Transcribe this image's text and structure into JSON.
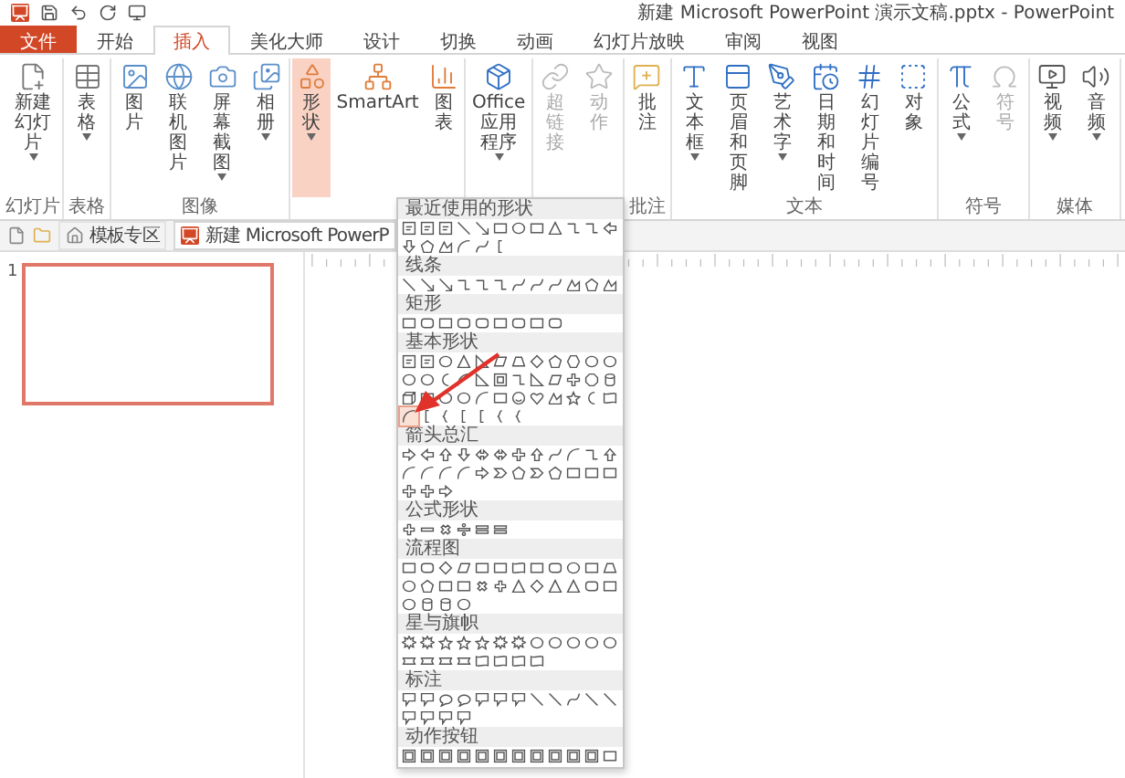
{
  "window": {
    "title": "新建 Microsoft PowerPoint 演示文稿.pptx - PowerPoint"
  },
  "tabs": [
    {
      "label": "文件",
      "kind": "file",
      "selected": false
    },
    {
      "label": "开始",
      "kind": "tab",
      "selected": false
    },
    {
      "label": "插入",
      "kind": "tab",
      "selected": true
    },
    {
      "label": "美化大师",
      "kind": "tab",
      "selected": false
    },
    {
      "label": "设计",
      "kind": "tab",
      "selected": false
    },
    {
      "label": "切换",
      "kind": "tab",
      "selected": false
    },
    {
      "label": "动画",
      "kind": "tab",
      "selected": false
    },
    {
      "label": "幻灯片放映",
      "kind": "tab",
      "selected": false
    },
    {
      "label": "审阅",
      "kind": "tab",
      "selected": false
    },
    {
      "label": "视图",
      "kind": "tab",
      "selected": false
    }
  ],
  "ribbon": [
    {
      "label": "幻灯片",
      "items": [
        {
          "label": "新建幻灯片",
          "menu": true,
          "disabled": false,
          "open": false
        }
      ]
    },
    {
      "label": "表格",
      "items": [
        {
          "label": "表格",
          "menu": true,
          "disabled": false,
          "open": false
        }
      ]
    },
    {
      "label": "图像",
      "items": [
        {
          "label": "图片",
          "menu": false,
          "disabled": false,
          "open": false
        },
        {
          "label": "联机图片",
          "menu": false,
          "disabled": false,
          "open": false
        },
        {
          "label": "屏幕截图",
          "menu": true,
          "disabled": false,
          "open": false
        },
        {
          "label": "相册",
          "menu": true,
          "disabled": false,
          "open": false
        }
      ]
    },
    {
      "items": [
        {
          "label": "形状",
          "menu": true,
          "disabled": false,
          "open": true
        },
        {
          "label": "SmartArt",
          "menu": false,
          "disabled": false,
          "open": false
        },
        {
          "label": "图表",
          "menu": false,
          "disabled": false,
          "open": false
        }
      ]
    },
    {
      "items": [
        {
          "label": "Office 应用程序",
          "menu": true,
          "disabled": false,
          "open": false
        }
      ]
    },
    {
      "items": [
        {
          "label": "超链接",
          "menu": false,
          "disabled": true,
          "open": false
        },
        {
          "label": "动作",
          "menu": false,
          "disabled": true,
          "open": false
        }
      ]
    },
    {
      "label": "批注",
      "items": [
        {
          "label": "批注",
          "menu": false,
          "disabled": false,
          "open": false
        }
      ]
    },
    {
      "label": "文本",
      "items": [
        {
          "label": "文本框",
          "menu": true,
          "disabled": false,
          "open": false
        },
        {
          "label": "页眉和页脚",
          "menu": false,
          "disabled": false,
          "open": false
        },
        {
          "label": "艺术字",
          "menu": true,
          "disabled": false,
          "open": false
        },
        {
          "label": "日期和时间",
          "menu": false,
          "disabled": false,
          "open": false
        },
        {
          "label": "幻灯片编号",
          "menu": false,
          "disabled": false,
          "open": false
        },
        {
          "label": "对象",
          "menu": false,
          "disabled": false,
          "open": false
        }
      ]
    },
    {
      "label": "符号",
      "items": [
        {
          "label": "公式",
          "menu": true,
          "disabled": false,
          "open": false
        },
        {
          "label": "符号",
          "menu": false,
          "disabled": true,
          "open": false
        }
      ]
    },
    {
      "label": "媒体",
      "items": [
        {
          "label": "视频",
          "menu": true,
          "disabled": false,
          "open": false
        },
        {
          "label": "音频",
          "menu": true,
          "disabled": false,
          "open": false
        }
      ]
    }
  ],
  "doc_tabs": [
    {
      "label": "模板专区",
      "kind": "home",
      "selected": false
    },
    {
      "label": "新建 Microsoft PowerP",
      "kind": "ppt",
      "selected": true
    }
  ],
  "slides": [
    {
      "number": "1",
      "selected": true
    }
  ],
  "annotation": {
    "kind": "arrow"
  },
  "shape_gallery": [
    {
      "title": "最近使用的形状",
      "shapes": [
        {
          "kind": "textbox",
          "selected": false
        },
        {
          "kind": "textbox",
          "selected": false
        },
        {
          "kind": "textbox",
          "selected": false
        },
        {
          "kind": "line",
          "selected": false
        },
        {
          "kind": "arrow-line",
          "selected": false
        },
        {
          "kind": "rect",
          "selected": false
        },
        {
          "kind": "oval",
          "selected": false
        },
        {
          "kind": "rect",
          "selected": false
        },
        {
          "kind": "triangle",
          "selected": false
        },
        {
          "kind": "elbow",
          "selected": false
        },
        {
          "kind": "elbow",
          "selected": false
        },
        {
          "kind": "arrow-left",
          "selected": false
        },
        {
          "kind": "arrow-down",
          "selected": false
        },
        {
          "kind": "pentagon",
          "selected": false
        },
        {
          "kind": "freeform",
          "selected": false
        },
        {
          "kind": "arc",
          "selected": false
        },
        {
          "kind": "curve",
          "selected": false
        },
        {
          "kind": "bracket",
          "selected": false
        }
      ]
    },
    {
      "title": "线条",
      "shapes": [
        {
          "kind": "line",
          "selected": false
        },
        {
          "kind": "arrow-line",
          "selected": false
        },
        {
          "kind": "arrow-line",
          "selected": false
        },
        {
          "kind": "elbow",
          "selected": false
        },
        {
          "kind": "elbow",
          "selected": false
        },
        {
          "kind": "elbow",
          "selected": false
        },
        {
          "kind": "curve",
          "selected": false
        },
        {
          "kind": "curve",
          "selected": false
        },
        {
          "kind": "curve",
          "selected": false
        },
        {
          "kind": "freeform",
          "selected": false
        },
        {
          "kind": "pentagon",
          "selected": false
        },
        {
          "kind": "freeform",
          "selected": false
        }
      ]
    },
    {
      "title": "矩形",
      "shapes": [
        {
          "kind": "rect",
          "selected": false
        },
        {
          "kind": "roundrect",
          "selected": false
        },
        {
          "kind": "rect",
          "selected": false
        },
        {
          "kind": "roundrect",
          "selected": false
        },
        {
          "kind": "roundrect",
          "selected": false
        },
        {
          "kind": "rect",
          "selected": false
        },
        {
          "kind": "roundrect",
          "selected": false
        },
        {
          "kind": "rect",
          "selected": false
        },
        {
          "kind": "roundrect",
          "selected": false
        }
      ]
    },
    {
      "title": "基本形状",
      "shapes": [
        {
          "kind": "textbox",
          "selected": false
        },
        {
          "kind": "textbox",
          "selected": false
        },
        {
          "kind": "oval",
          "selected": false
        },
        {
          "kind": "triangle",
          "selected": false
        },
        {
          "kind": "rtriangle",
          "selected": false
        },
        {
          "kind": "parallelogram",
          "selected": false
        },
        {
          "kind": "trapezoid",
          "selected": false
        },
        {
          "kind": "diamond",
          "selected": false
        },
        {
          "kind": "pentagon",
          "selected": false
        },
        {
          "kind": "hexagon",
          "selected": false
        },
        {
          "kind": "oval",
          "selected": false
        },
        {
          "kind": "oval",
          "selected": false
        },
        {
          "kind": "oval",
          "selected": false
        },
        {
          "kind": "oval",
          "selected": false
        },
        {
          "kind": "moon",
          "selected": false
        },
        {
          "kind": "arc",
          "selected": false
        },
        {
          "kind": "rtriangle",
          "selected": false
        },
        {
          "kind": "frame",
          "selected": false
        },
        {
          "kind": "elbow",
          "selected": false
        },
        {
          "kind": "rtriangle",
          "selected": false
        },
        {
          "kind": "parallelogram",
          "selected": false
        },
        {
          "kind": "cross",
          "selected": false
        },
        {
          "kind": "octagon",
          "selected": false
        },
        {
          "kind": "cylinder",
          "selected": false
        },
        {
          "kind": "cube",
          "selected": false
        },
        {
          "kind": "rect",
          "selected": false
        },
        {
          "kind": "oval",
          "selected": false
        },
        {
          "kind": "oval",
          "selected": false
        },
        {
          "kind": "arc",
          "selected": false
        },
        {
          "kind": "rect",
          "selected": false
        },
        {
          "kind": "smile",
          "selected": false
        },
        {
          "kind": "heart",
          "selected": false
        },
        {
          "kind": "freeform",
          "selected": false
        },
        {
          "kind": "star",
          "selected": false
        },
        {
          "kind": "moon",
          "selected": false
        },
        {
          "kind": "wave",
          "selected": false
        },
        {
          "kind": "arc",
          "selected": true
        },
        {
          "kind": "bracket",
          "selected": false
        },
        {
          "kind": "brace",
          "selected": false
        },
        {
          "kind": "bracket",
          "selected": false
        },
        {
          "kind": "bracket",
          "selected": false
        },
        {
          "kind": "brace",
          "selected": false
        },
        {
          "kind": "brace",
          "selected": false
        }
      ]
    },
    {
      "title": "箭头总汇",
      "shapes": [
        {
          "kind": "arrow-right",
          "selected": false
        },
        {
          "kind": "arrow-left",
          "selected": false
        },
        {
          "kind": "arrow-up",
          "selected": false
        },
        {
          "kind": "arrow-down",
          "selected": false
        },
        {
          "kind": "arrow-both",
          "selected": false
        },
        {
          "kind": "arrow-both",
          "selected": false
        },
        {
          "kind": "cross",
          "selected": false
        },
        {
          "kind": "arrow-up",
          "selected": false
        },
        {
          "kind": "curve",
          "selected": false
        },
        {
          "kind": "arc",
          "selected": false
        },
        {
          "kind": "elbow",
          "selected": false
        },
        {
          "kind": "arrow-up",
          "selected": false
        },
        {
          "kind": "arc",
          "selected": false
        },
        {
          "kind": "arc",
          "selected": false
        },
        {
          "kind": "arc",
          "selected": false
        },
        {
          "kind": "arc",
          "selected": false
        },
        {
          "kind": "arrow-right",
          "selected": false
        },
        {
          "kind": "chevron",
          "selected": false
        },
        {
          "kind": "pentagon",
          "selected": false
        },
        {
          "kind": "chevron",
          "selected": false
        },
        {
          "kind": "pentagon",
          "selected": false
        },
        {
          "kind": "rect",
          "selected": false
        },
        {
          "kind": "rect",
          "selected": false
        },
        {
          "kind": "rect",
          "selected": false
        },
        {
          "kind": "cross",
          "selected": false
        },
        {
          "kind": "cross",
          "selected": false
        },
        {
          "kind": "arrow-right",
          "selected": false
        }
      ]
    },
    {
      "title": "公式形状",
      "shapes": [
        {
          "kind": "plus",
          "selected": false
        },
        {
          "kind": "minus",
          "selected": false
        },
        {
          "kind": "multiply",
          "selected": false
        },
        {
          "kind": "divide",
          "selected": false
        },
        {
          "kind": "equal",
          "selected": false
        },
        {
          "kind": "equal",
          "selected": false
        }
      ]
    },
    {
      "title": "流程图",
      "shapes": [
        {
          "kind": "rect",
          "selected": false
        },
        {
          "kind": "roundrect",
          "selected": false
        },
        {
          "kind": "diamond",
          "selected": false
        },
        {
          "kind": "parallelogram",
          "selected": false
        },
        {
          "kind": "rect",
          "selected": false
        },
        {
          "kind": "rect",
          "selected": false
        },
        {
          "kind": "wave",
          "selected": false
        },
        {
          "kind": "rect",
          "selected": false
        },
        {
          "kind": "roundrect",
          "selected": false
        },
        {
          "kind": "oval",
          "selected": false
        },
        {
          "kind": "rect",
          "selected": false
        },
        {
          "kind": "trapezoid",
          "selected": false
        },
        {
          "kind": "oval",
          "selected": false
        },
        {
          "kind": "pentagon",
          "selected": false
        },
        {
          "kind": "rect",
          "selected": false
        },
        {
          "kind": "rect",
          "selected": false
        },
        {
          "kind": "multiply",
          "selected": false
        },
        {
          "kind": "plus",
          "selected": false
        },
        {
          "kind": "triangle",
          "selected": false
        },
        {
          "kind": "diamond",
          "selected": false
        },
        {
          "kind": "triangle",
          "selected": false
        },
        {
          "kind": "triangle",
          "selected": false
        },
        {
          "kind": "roundrect",
          "selected": false
        },
        {
          "kind": "rect",
          "selected": false
        },
        {
          "kind": "oval",
          "selected": false
        },
        {
          "kind": "cylinder",
          "selected": false
        },
        {
          "kind": "cylinder",
          "selected": false
        },
        {
          "kind": "oval",
          "selected": false
        }
      ]
    },
    {
      "title": "星与旗帜",
      "shapes": [
        {
          "kind": "burst",
          "selected": false
        },
        {
          "kind": "burst",
          "selected": false
        },
        {
          "kind": "star",
          "selected": false
        },
        {
          "kind": "star",
          "selected": false
        },
        {
          "kind": "star",
          "selected": false
        },
        {
          "kind": "burst",
          "selected": false
        },
        {
          "kind": "burst",
          "selected": false
        },
        {
          "kind": "oval",
          "selected": false
        },
        {
          "kind": "oval",
          "selected": false
        },
        {
          "kind": "oval",
          "selected": false
        },
        {
          "kind": "oval",
          "selected": false
        },
        {
          "kind": "oval",
          "selected": false
        },
        {
          "kind": "ribbon",
          "selected": false
        },
        {
          "kind": "ribbon",
          "selected": false
        },
        {
          "kind": "ribbon",
          "selected": false
        },
        {
          "kind": "ribbon",
          "selected": false
        },
        {
          "kind": "wave",
          "selected": false
        },
        {
          "kind": "wave",
          "selected": false
        },
        {
          "kind": "wave",
          "selected": false
        },
        {
          "kind": "wave",
          "selected": false
        }
      ]
    },
    {
      "title": "标注",
      "shapes": [
        {
          "kind": "callout",
          "selected": false
        },
        {
          "kind": "callout",
          "selected": false
        },
        {
          "kind": "callout-oval",
          "selected": false
        },
        {
          "kind": "callout-oval",
          "selected": false
        },
        {
          "kind": "callout",
          "selected": false
        },
        {
          "kind": "callout",
          "selected": false
        },
        {
          "kind": "callout",
          "selected": false
        },
        {
          "kind": "line",
          "selected": false
        },
        {
          "kind": "line",
          "selected": false
        },
        {
          "kind": "curve",
          "selected": false
        },
        {
          "kind": "line",
          "selected": false
        },
        {
          "kind": "line",
          "selected": false
        },
        {
          "kind": "callout",
          "selected": false
        },
        {
          "kind": "callout",
          "selected": false
        },
        {
          "kind": "callout",
          "selected": false
        },
        {
          "kind": "callout",
          "selected": false
        }
      ]
    },
    {
      "title": "动作按钮",
      "shapes": [
        {
          "kind": "button",
          "selected": false
        },
        {
          "kind": "button",
          "selected": false
        },
        {
          "kind": "button",
          "selected": false
        },
        {
          "kind": "button",
          "selected": false
        },
        {
          "kind": "button",
          "selected": false
        },
        {
          "kind": "button",
          "selected": false
        },
        {
          "kind": "button",
          "selected": false
        },
        {
          "kind": "button",
          "selected": false
        },
        {
          "kind": "button",
          "selected": false
        },
        {
          "kind": "button",
          "selected": false
        },
        {
          "kind": "button",
          "selected": false
        },
        {
          "kind": "rect",
          "selected": false
        }
      ]
    }
  ]
}
